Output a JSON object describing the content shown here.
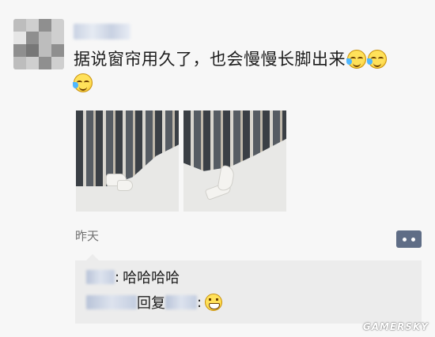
{
  "post": {
    "text": "据说窗帘用久了，也会慢慢长脚出来",
    "emoji_names": [
      "crying-laughing-icon",
      "crying-laughing-icon",
      "crying-laughing-icon"
    ],
    "time": "昨天"
  },
  "comments": [
    {
      "text": "哈哈哈哈"
    },
    {
      "reply_word": "回复",
      "emoji": "grinning-icon"
    }
  ],
  "watermark": "GAMERSKY",
  "colors": {
    "action_button": "#5f6d86",
    "background": "#f7f7f7",
    "comment_bg": "#ececec"
  }
}
